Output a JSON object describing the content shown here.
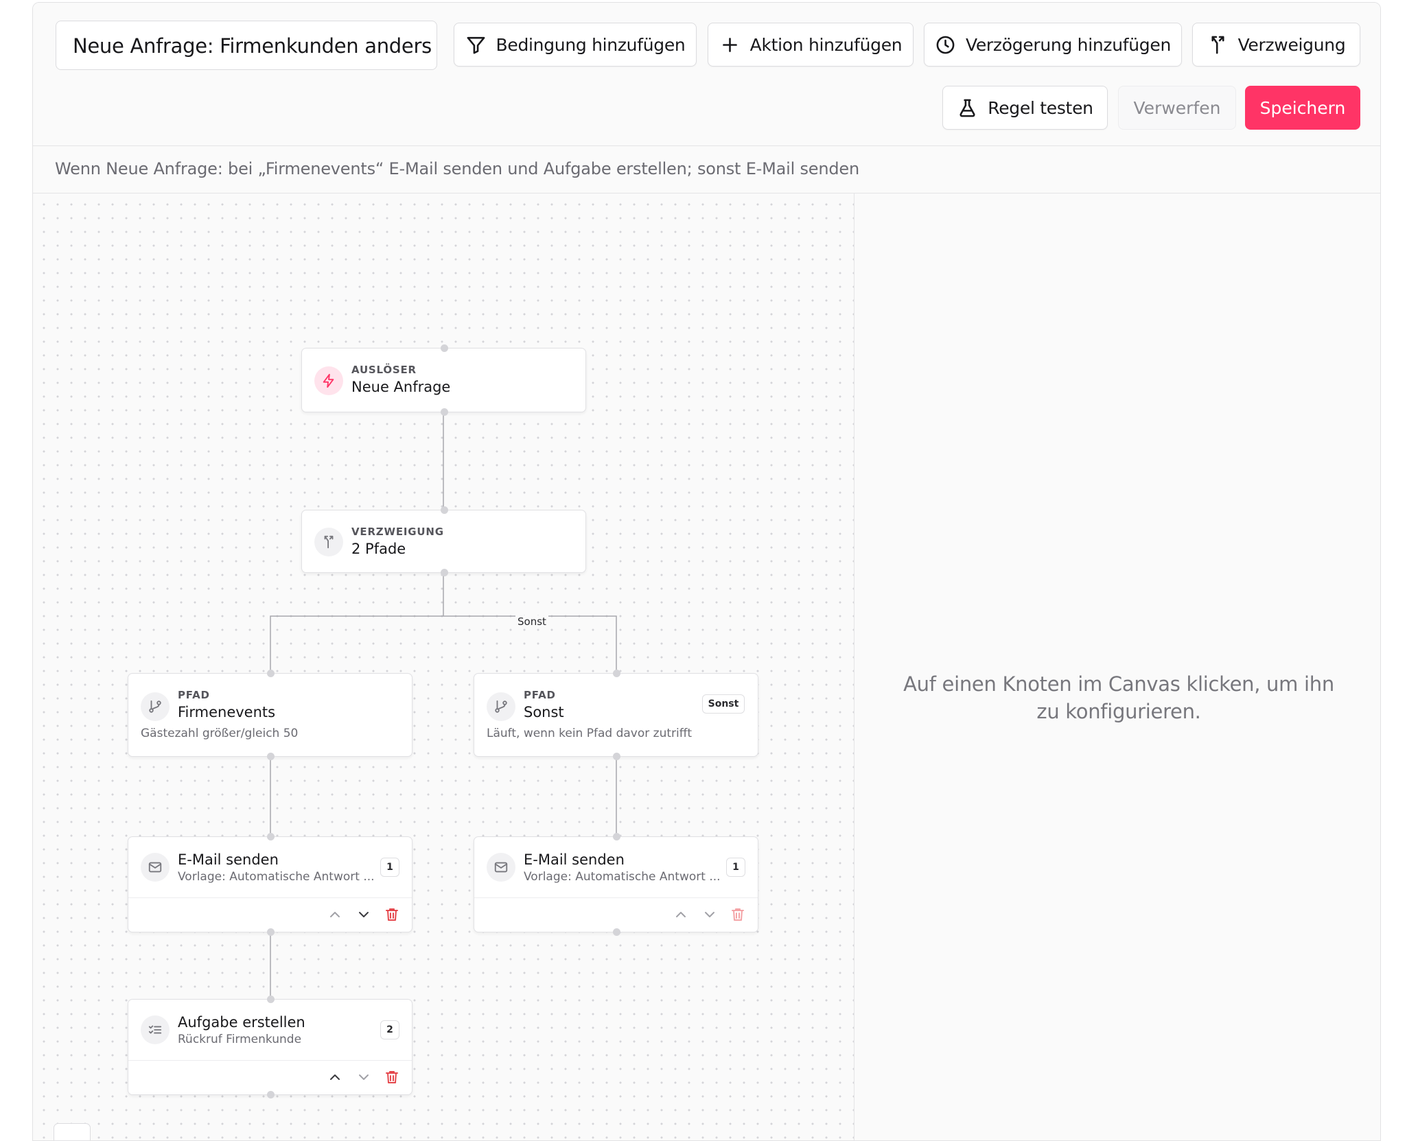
{
  "toolbar": {
    "rule_name": "Neue Anfrage: Firmenkunden anders b",
    "add_condition": "Bedingung hinzufügen",
    "add_action": "Aktion hinzufügen",
    "add_delay": "Verzögerung hinzufügen",
    "add_branch": "Verzweigung",
    "test_rule": "Regel testen",
    "discard": "Verwerfen",
    "save": "Speichern"
  },
  "summary": "Wenn Neue Anfrage: bei „Firmenevents“ E-Mail senden und Aufgabe erstellen; sonst E-Mail senden",
  "canvas": {
    "trigger": {
      "kicker": "AUSLÖSER",
      "title": "Neue Anfrage",
      "icon": "lightning-icon"
    },
    "branch": {
      "kicker": "VERZWEIGUNG",
      "title": "2 Pfade",
      "icon": "branch-icon"
    },
    "edge_label": "Sonst",
    "path_left": {
      "kicker": "PFAD",
      "title": "Firmenevents",
      "sub": "Gästezahl größer/gleich 50",
      "icon": "git-branch-icon"
    },
    "path_right": {
      "kicker": "PFAD",
      "title": "Sonst",
      "sub": "Läuft, wenn kein Pfad davor zutrifft",
      "badge": "Sonst",
      "icon": "git-branch-icon"
    },
    "action_left_1": {
      "title": "E-Mail senden",
      "sub": "Vorlage: Automatische Antwort ...",
      "order": "1",
      "icon": "mail-icon"
    },
    "action_right_1": {
      "title": "E-Mail senden",
      "sub": "Vorlage: Automatische Antwort ...",
      "order": "1",
      "icon": "mail-icon"
    },
    "action_left_2": {
      "title": "Aufgabe erstellen",
      "sub": "Rückruf Firmenkunde",
      "order": "2",
      "icon": "task-list-icon"
    }
  },
  "panel": {
    "hint": "Auf einen Knoten im Canvas klicken, um ihn zu konfigurieren."
  },
  "colors": {
    "accent": "#ff3466",
    "danger": "#e5484d"
  }
}
